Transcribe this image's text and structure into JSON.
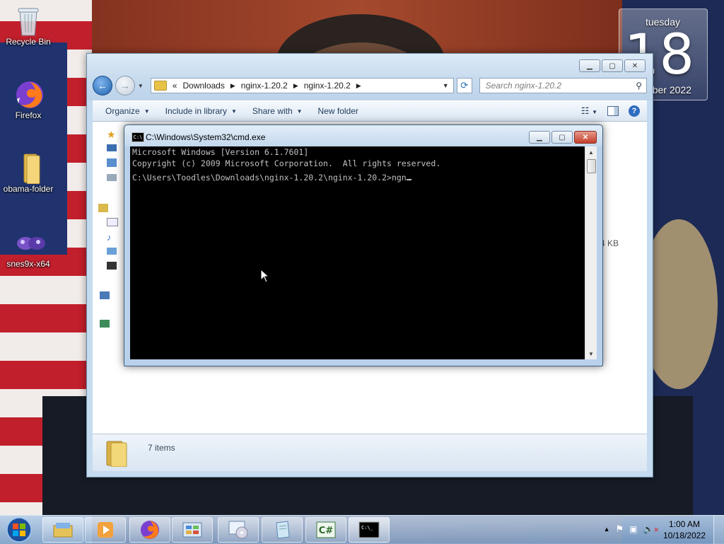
{
  "desktop": {
    "icons": [
      {
        "label": "Recycle Bin"
      },
      {
        "label": "Firefox"
      },
      {
        "label": "obama-folder"
      },
      {
        "label": "snes9x-x64"
      }
    ],
    "gadget": {
      "weekday": "tuesday",
      "day": "18",
      "month_year": "ober 2022"
    }
  },
  "explorer": {
    "breadcrumb_prefix": "«",
    "breadcrumb": [
      "Downloads",
      "nginx-1.20.2",
      "nginx-1.20.2"
    ],
    "search_placeholder": "Search nginx-1.20.2",
    "toolbar": {
      "organize": "Organize",
      "include": "Include in library",
      "share": "Share with",
      "new_folder": "New folder"
    },
    "size_fragment": "4 KB",
    "status": {
      "items": "7 items"
    }
  },
  "cmd": {
    "title": "C:\\Windows\\System32\\cmd.exe",
    "lines": [
      "Microsoft Windows [Version 6.1.7601]",
      "Copyright (c) 2009 Microsoft Corporation.  All rights reserved.",
      "",
      "C:\\Users\\Toodles\\Downloads\\nginx-1.20.2\\nginx-1.20.2>ngn"
    ]
  },
  "taskbar": {
    "time": "1:00 AM",
    "date": "10/18/2022"
  }
}
